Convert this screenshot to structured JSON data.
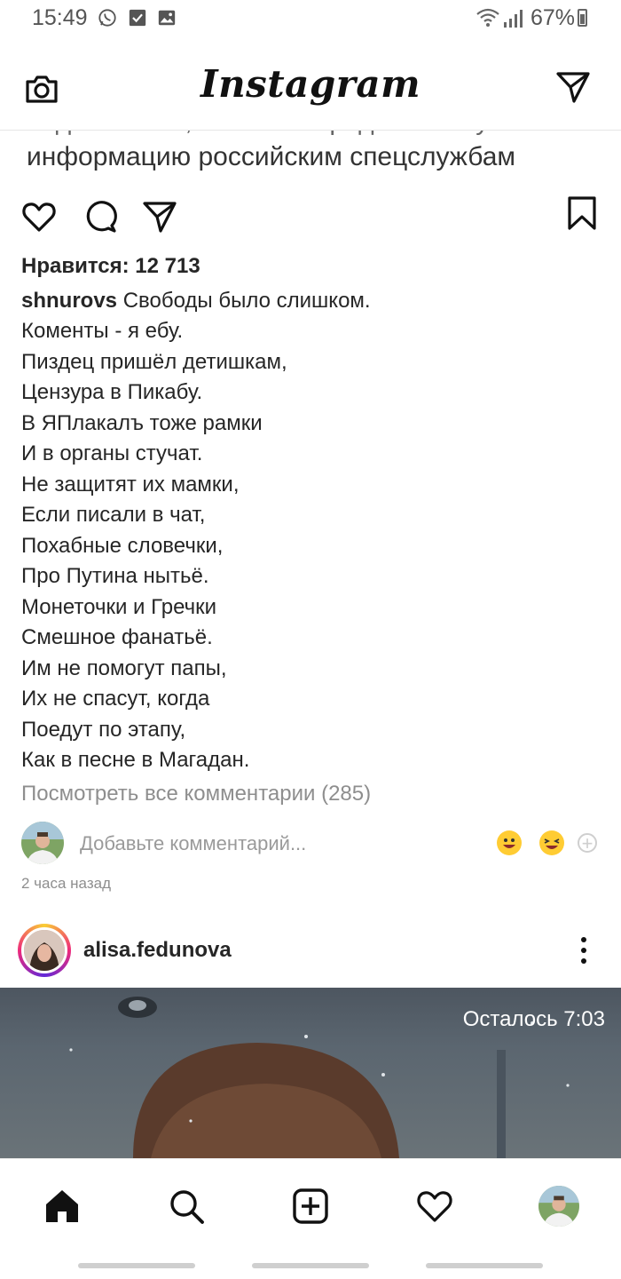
{
  "status_bar": {
    "time": "15:49",
    "battery": "67%"
  },
  "header": {
    "logo": "Instagram"
  },
  "post": {
    "image_text": "информацию российским спецслужбам",
    "image_text_cut": "видеозаписи, а также передавать эту",
    "likes": "Нравится: 12 713",
    "caption_user": "shnurovs",
    "caption_first": "Свободы было слишком.",
    "caption_lines": [
      "Коменты - я ебу.",
      "Пиздец пришёл детишкам,",
      "Цензура в Пикабу.",
      "В ЯПлакалъ тоже рамки",
      "И в органы стучат.",
      "Не защитят их мамки,",
      "Если писали в чат,",
      "Похабные словечки,",
      "Про Путина нытьё.",
      "Монеточки и Гречки",
      "Смешное фанатьё.",
      "Им не помогут папы,",
      "Их не спасут, когда",
      "Поедут по этапу,",
      "Как в песне в Магадан."
    ],
    "view_comments": "Посмотреть все комментарии (285)",
    "comment_placeholder": "Добавьте комментарий...",
    "timestamp": "2 часа назад"
  },
  "next_post": {
    "username": "alisa.fedunova",
    "remaining": "Осталось 7:03"
  },
  "icons": {
    "status": [
      "whatsapp-icon",
      "checkbox-icon",
      "gallery-icon",
      "wifi-icon",
      "signal-icon",
      "battery-icon"
    ],
    "header": [
      "camera-icon",
      "direct-message-icon"
    ],
    "actions": [
      "heart-icon",
      "comment-icon",
      "share-icon",
      "bookmark-icon"
    ],
    "nav": [
      "home-icon",
      "search-icon",
      "add-post-icon",
      "activity-heart-icon",
      "profile-avatar"
    ]
  }
}
